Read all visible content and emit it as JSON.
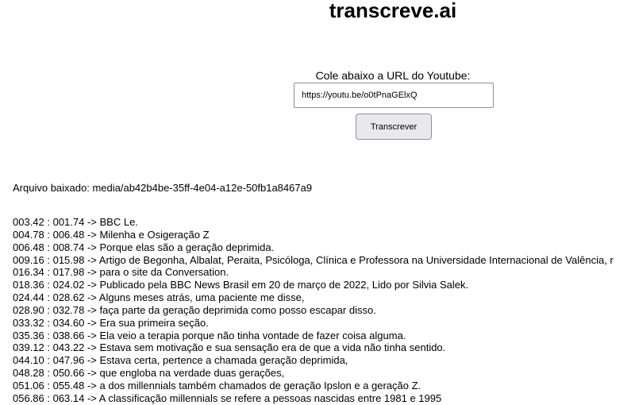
{
  "app": {
    "title": "transcreve.ai"
  },
  "form": {
    "label": "Cole abaixo a URL do Youtube:",
    "url_value": "https://youtu.be/o0tPnaGElxQ",
    "submit_label": "Transcrever"
  },
  "download": {
    "text": "Arquivo baixado: media/ab42b4be-35ff-4e04-a12e-50fb1a8467a9"
  },
  "transcript": [
    "003.42 : 001.74 -> BBC Le.",
    "004.78 : 006.48 -> Milenha e Osigeração Z",
    "006.48 : 008.74 -> Porque elas são a geração deprimida.",
    "009.16 : 015.98 -> Artigo de Begonha, Albalat, Peraita, Psicóloga, Clínica e Professora na Universidade Internacional de Valência, r",
    "016.34 : 017.98 -> para o site da Conversation.",
    "018.36 : 024.02 -> Publicado pela BBC News Brasil em 20 de março de 2022, Lido por Silvia Salek.",
    "024.44 : 028.62 -> Alguns meses atrás, uma paciente me disse,",
    "028.90 : 032.78 -> faça parte da geração deprimida como posso escapar disso.",
    "033.32 : 034.60 -> Era sua primeira seção.",
    "035.36 : 038.66 -> Ela veio a terapia porque não tinha vontade de fazer coisa alguma.",
    "039.12 : 043.22 -> Estava sem motivação e sua sensação era de que a vida não tinha sentido.",
    "044.10 : 047.96 -> Estava certa, pertence a chamada geração deprimida,",
    "048.28 : 050.66 -> que engloba na verdade duas gerações,",
    "051.06 : 055.48 -> a dos millennials também chamados de geração Ipslon e a geração Z.",
    "056.86 : 063.14 -> A classificação millennials se refere a pessoas nascidas entre 1981 e 1995"
  ]
}
